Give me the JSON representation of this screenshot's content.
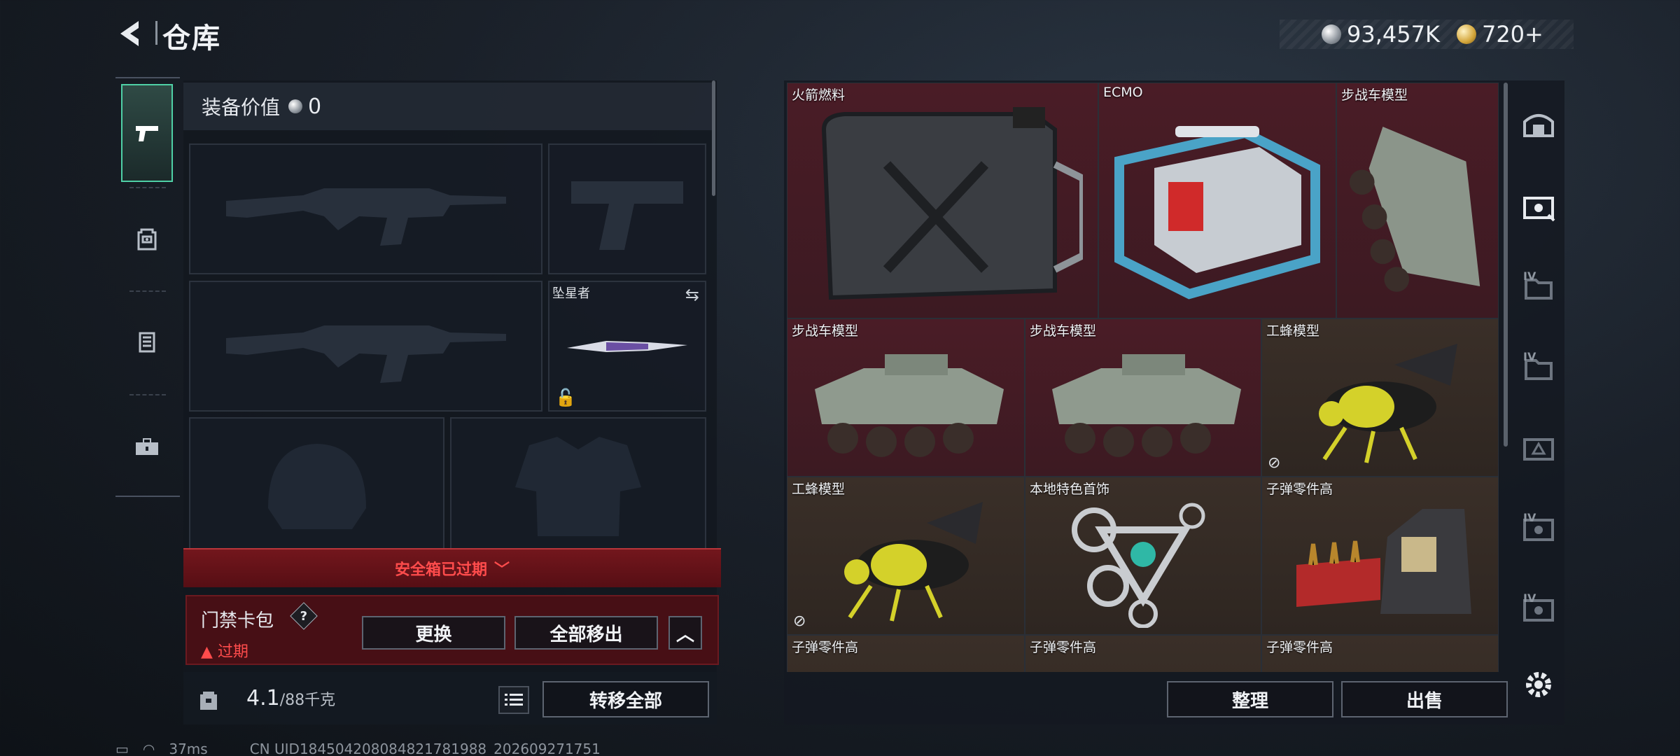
{
  "header": {
    "title": "仓库",
    "currency_silver": "93,457K",
    "currency_gold": "720+"
  },
  "left_nav": {
    "items": [
      "weapon",
      "backpack",
      "chest-rig",
      "toolbox"
    ]
  },
  "loadout": {
    "equip_value_label": "装备价值",
    "equip_value": "0",
    "melee_label": "坠星者",
    "safe_box_status": "安全箱已过期",
    "card_pack_label": "门禁卡包",
    "card_pack_help": "?",
    "expired_label": "过期",
    "replace_label": "更换",
    "remove_all_label": "全部移出",
    "weight_current": "4.1",
    "weight_capacity": "/88千克",
    "transfer_all_label": "转移全部"
  },
  "stash": {
    "items": [
      {
        "name": "火箭燃料",
        "bg": "red"
      },
      {
        "name": "ECMO",
        "bg": "red"
      },
      {
        "name": "步战车模型",
        "bg": "red"
      },
      {
        "name": "步战车模型",
        "bg": "red"
      },
      {
        "name": "步战车模型",
        "bg": "red"
      },
      {
        "name": "工蜂模型",
        "bg": "gold"
      },
      {
        "name": "工蜂模型",
        "bg": "gold"
      },
      {
        "name": "本地特色首饰",
        "bg": "gold"
      },
      {
        "name": "子弹零件高",
        "bg": "gold"
      },
      {
        "name": "子弹零件高",
        "bg": "gold"
      },
      {
        "name": "子弹零件高",
        "bg": "gold"
      },
      {
        "name": "子弹零件高",
        "bg": "gold"
      }
    ],
    "sort_label": "整理",
    "sell_label": "出售"
  },
  "status_bar": {
    "ping": "37ms",
    "uid": "CN UID1845042080848217819​88_202609271751"
  },
  "colors": {
    "accent_green": "#4fd0a6",
    "alert_red": "#ff4c4c",
    "rarity_red": "#4a1c26",
    "rarity_gold": "#3a2f28"
  }
}
